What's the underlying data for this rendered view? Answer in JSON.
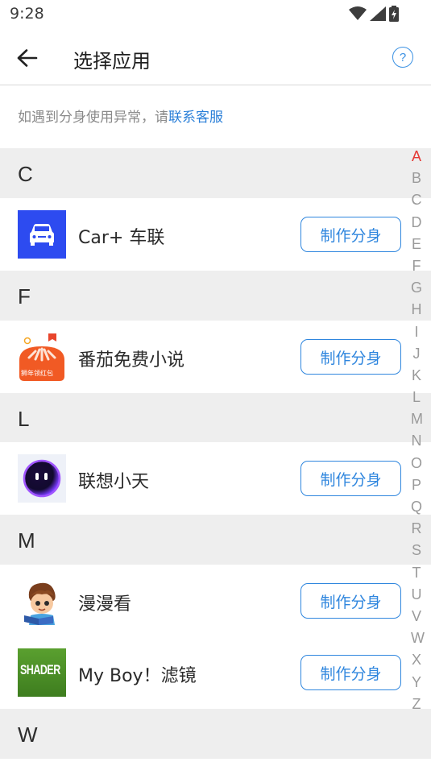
{
  "status_bar": {
    "time": "9:28"
  },
  "header": {
    "title": "选择应用",
    "help_label": "?"
  },
  "notice": {
    "text": "如遇到分身使用异常，请",
    "link": "联系客服"
  },
  "sections": [
    {
      "letter": "C",
      "apps": [
        {
          "name": "Car+ 车联",
          "button": "制作分身"
        }
      ]
    },
    {
      "letter": "F",
      "apps": [
        {
          "name": "番茄免费小说",
          "button": "制作分身",
          "icon_caption": "狮年领红包"
        }
      ]
    },
    {
      "letter": "L",
      "apps": [
        {
          "name": "联想小天",
          "button": "制作分身"
        }
      ]
    },
    {
      "letter": "M",
      "apps": [
        {
          "name": "漫漫看",
          "button": "制作分身"
        },
        {
          "name": "My Boy！滤镜",
          "button": "制作分身",
          "icon_text": "SHADER"
        }
      ]
    },
    {
      "letter": "W",
      "apps": []
    }
  ],
  "index_bar": {
    "letters": [
      "A",
      "B",
      "C",
      "D",
      "E",
      "F",
      "G",
      "H",
      "I",
      "J",
      "K",
      "L",
      "M",
      "N",
      "O",
      "P",
      "Q",
      "R",
      "S",
      "T",
      "U",
      "V",
      "W",
      "X",
      "Y",
      "Z"
    ],
    "active": "A"
  },
  "colors": {
    "accent": "#2f86de",
    "index_active": "#e53935",
    "section_bg": "#eeeeee"
  }
}
